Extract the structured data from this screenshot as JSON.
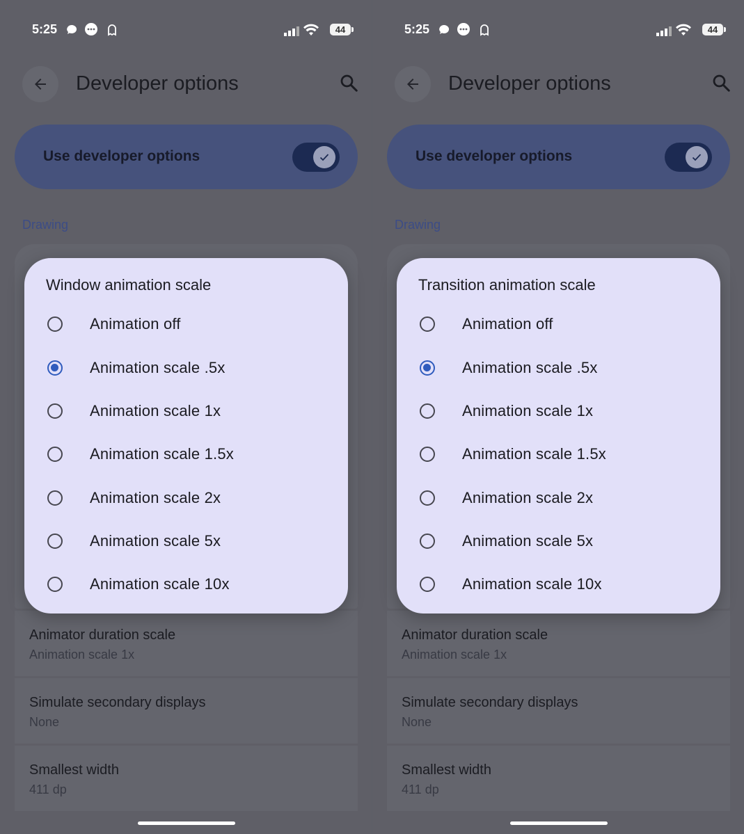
{
  "status_bar": {
    "time": "5:25",
    "battery": "44"
  },
  "app_bar": {
    "title": "Developer options"
  },
  "master": {
    "label": "Use developer options",
    "enabled": true
  },
  "section": {
    "label": "Drawing"
  },
  "background_prefs": [
    {
      "title": "Animator duration scale",
      "summary": "Animation scale 1x"
    },
    {
      "title": "Simulate secondary displays",
      "summary": "None"
    },
    {
      "title": "Smallest width",
      "summary": "411 dp"
    }
  ],
  "dialogs": {
    "left": {
      "title": "Window animation scale",
      "selected_index": 1
    },
    "right": {
      "title": "Transition animation scale",
      "selected_index": 1
    }
  },
  "options": [
    "Animation off",
    "Animation scale .5x",
    "Animation scale 1x",
    "Animation scale 1.5x",
    "Animation scale 2x",
    "Animation scale 5x",
    "Animation scale 10x"
  ],
  "colors": {
    "accent": "#2f5bbd",
    "dialog_bg": "#e2e0f9",
    "scrim": "#5f5f67",
    "toggle_card": "#46527c"
  }
}
